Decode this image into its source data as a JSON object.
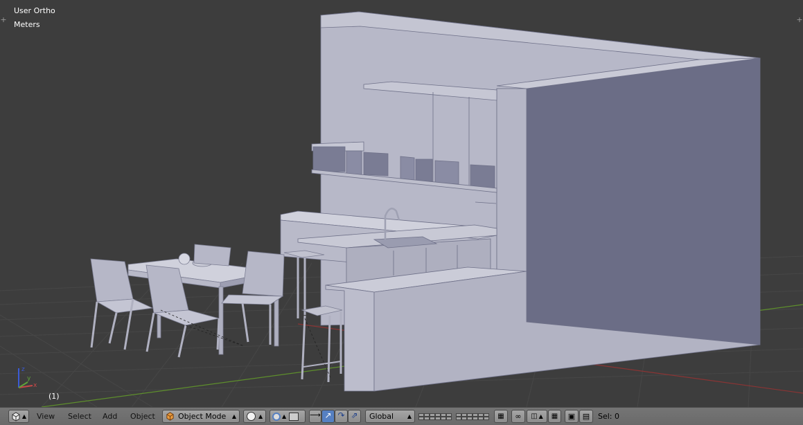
{
  "viewport": {
    "view_name": "User Ortho",
    "units": "Meters",
    "frame": "(1)",
    "axes": {
      "x": "x",
      "y": "y",
      "z": "z"
    }
  },
  "header": {
    "editor_type_icon": "3d-view-cube-icon",
    "menus": [
      "View",
      "Select",
      "Add",
      "Object"
    ],
    "mode": {
      "label": "Object Mode",
      "icon": "orange-cube-icon"
    },
    "viewport_shading_icon": "solid-sphere-icon",
    "pivot_icon": "pivot-point-icon",
    "manipulator_icons": [
      "manipulator-toggle-icon",
      "translate-arrow-icon",
      "rotate-arc-icon",
      "scale-icon"
    ],
    "orientation": "Global",
    "snap_icon": "magnet-icon",
    "render_icons": [
      "camera-icon",
      "clapperboard-icon"
    ],
    "selection_status": "Sel: 0"
  },
  "colors": {
    "background": "#3d3d3d",
    "grid": "#4a4a4a",
    "axis_x": "#9b3a3a",
    "axis_y": "#5f9b2b",
    "mesh": "#a9abbe",
    "header": "#727272",
    "selected_tool": "#5680c2"
  }
}
